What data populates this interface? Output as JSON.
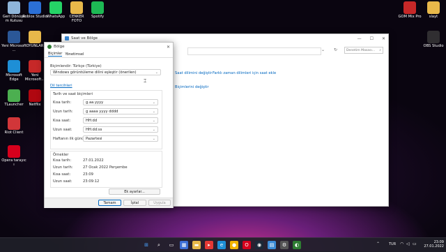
{
  "desktop_left": [
    {
      "label": "Geri Dönüşü m Kutusu",
      "icon": "recycle-bin-icon",
      "color": "#8fb4d9"
    },
    {
      "label": "Roblox Studio",
      "icon": "roblox-studio-icon",
      "color": "#2b6fd6"
    },
    {
      "label": "WhatsApp",
      "icon": "whatsapp-icon",
      "color": "#25d366"
    },
    {
      "label": "CENKER FOTO",
      "icon": "folder-icon",
      "color": "#e8b84a"
    },
    {
      "label": "Spotify",
      "icon": "spotify-icon",
      "color": "#1db954"
    },
    {
      "label": "Yeni Microsoft ...",
      "icon": "word-document-icon",
      "color": "#2b5797"
    },
    {
      "label": "OYUNLAR",
      "icon": "folder-icon",
      "color": "#e8b84a"
    },
    {
      "label": "Microsoft Edge",
      "icon": "edge-icon",
      "color": "#1e8fd6"
    },
    {
      "label": "Yeni Microsoft...",
      "icon": "pdf-document-icon",
      "color": "#c62828"
    },
    {
      "label": "TLauncher",
      "icon": "tlauncher-icon",
      "color": "#4caf50"
    },
    {
      "label": "Netflix",
      "icon": "netflix-icon",
      "color": "#b00710"
    },
    {
      "label": "Riot Client",
      "icon": "riot-client-icon",
      "color": "#d13639"
    },
    {
      "label": "Opera tarayıc ı",
      "icon": "opera-icon",
      "color": "#d6001c"
    }
  ],
  "desktop_right": [
    {
      "label": "GOM Mix Pro",
      "icon": "gom-mix-icon",
      "color": "#c62828"
    },
    {
      "label": "slayt",
      "icon": "folder-icon",
      "color": "#e8b84a"
    },
    {
      "label": "OBS Studio",
      "icon": "obs-icon",
      "color": "#302e31"
    }
  ],
  "back_window": {
    "title": "Saat ve Bölge",
    "search_placeholder": "Denetim Masası...",
    "link1": "Saat dilimini değiştir",
    "link2": "Farklı zaman dilimleri için saat ekle",
    "link3": "Biçimlerini değiştir"
  },
  "dialog": {
    "title": "Bölge",
    "tabs": [
      "Biçimler",
      "Yönetimsel"
    ],
    "format_label": "Biçimlendir: Türkçe (Türkiye)",
    "format_value": "Windows görüntüleme dilini eşleştir (önerilen)",
    "language_link": "Dil tercihleri",
    "section_datetime": "Tarih ve saat biçimleri",
    "fields": [
      {
        "label": "Kısa tarih:",
        "value": "g.aa.yyyy"
      },
      {
        "label": "Uzun tarih:",
        "value": "g aaaa yyyy dddd"
      },
      {
        "label": "Kısa saat:",
        "value": "HH:dd"
      },
      {
        "label": "Uzun saat:",
        "value": "HH:dd:ss"
      },
      {
        "label": "Haftanın ilk günü:",
        "value": "Pazartesi"
      }
    ],
    "section_examples": "Örnekler",
    "examples": [
      {
        "label": "Kısa tarih:",
        "value": "27.01.2022"
      },
      {
        "label": "Uzun tarih:",
        "value": "27 Ocak 2022 Perşembe"
      },
      {
        "label": "Kısa saat:",
        "value": "23:09"
      },
      {
        "label": "Uzun saat:",
        "value": "23:09:12"
      }
    ],
    "extra_button": "Ek ayarlar...",
    "ok": "Tamam",
    "cancel": "İptal",
    "apply": "Uygula"
  },
  "taskbar": {
    "language": "TUR",
    "time": "23:09",
    "date": "27.01.2022"
  }
}
